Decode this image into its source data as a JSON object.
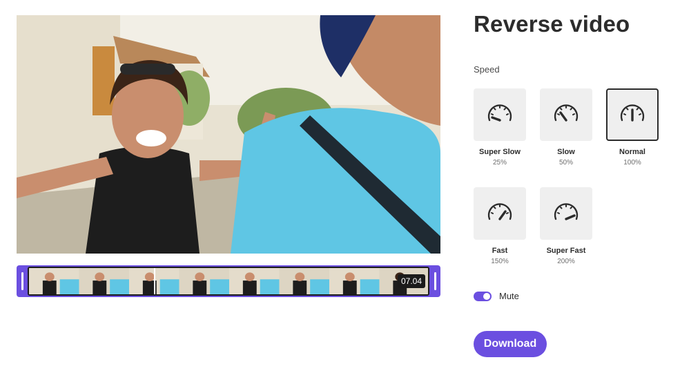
{
  "editor": {
    "title": "Reverse video",
    "speed_label": "Speed",
    "speed_options": [
      {
        "name": "Super Slow",
        "pct": "25%",
        "icon": "speedometer-super-slow-icon"
      },
      {
        "name": "Slow",
        "pct": "50%",
        "icon": "speedometer-slow-icon"
      },
      {
        "name": "Normal",
        "pct": "100%",
        "icon": "speedometer-normal-icon"
      },
      {
        "name": "Fast",
        "pct": "150%",
        "icon": "speedometer-fast-icon"
      },
      {
        "name": "Super Fast",
        "pct": "200%",
        "icon": "speedometer-super-fast-icon"
      }
    ],
    "selected_speed": "Normal",
    "mute_label": "Mute",
    "mute_on": true,
    "download_label": "Download"
  },
  "timeline": {
    "timecode": "07.04"
  },
  "colors": {
    "accent": "#6b4fe0",
    "tile_bg": "#efefef",
    "text": "#2c2c2c"
  }
}
